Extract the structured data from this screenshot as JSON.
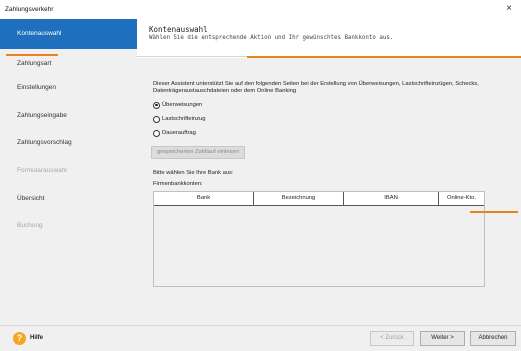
{
  "window": {
    "title": "Zahlungsverkehr",
    "close_glyph": "×"
  },
  "sidebar": {
    "items": [
      {
        "label": "Kontenauswahl",
        "state": "active"
      },
      {
        "label": "Zahlungsart",
        "state": "normal"
      },
      {
        "label": "Einstellungen",
        "state": "normal"
      },
      {
        "label": "Zahlungseingabe",
        "state": "normal"
      },
      {
        "label": "Zahlungsvorschlag",
        "state": "normal"
      },
      {
        "label": "Formularauswahl",
        "state": "disabled"
      },
      {
        "label": "Übersicht",
        "state": "normal"
      },
      {
        "label": "Buchung",
        "state": "disabled"
      }
    ]
  },
  "header": {
    "title": "Kontenauswahl",
    "subtitle": "Wählen Sie die entsprechende Aktion und Ihr gewünschtes Bankkonto aus."
  },
  "main": {
    "intro": "Dieser Assistent unterstützt Sie auf den folgenden Seiten bei der Erstellung von Überweisungen, Lastschrifteinzügen, Schecks, Datenträgeraustauschdateien oder dem Online Banking",
    "options": [
      {
        "label": "Überweisungen",
        "checked": true
      },
      {
        "label": "Lastschrifteinzug",
        "checked": false
      },
      {
        "label": "Dauerauftrag",
        "checked": false
      }
    ],
    "load_button": "gespeicherten Zahllauf einlesen",
    "bank_prompt": "Bitte wählen Sie Ihre Bank aus:",
    "firm_label": "Firmenbankkonten:",
    "table": {
      "columns": [
        "Bank",
        "Bezeichnung",
        "IBAN",
        "Online-Kto."
      ],
      "rows": []
    }
  },
  "footer": {
    "help_icon": "?",
    "help_label": "Hilfe",
    "back_button": "< Zurück",
    "next_button": "Weiter >",
    "cancel_button": "Abbrechen"
  },
  "colors": {
    "accent": "#1f6fbf",
    "highlight": "#e8821e",
    "panel": "#f0f0f0"
  }
}
